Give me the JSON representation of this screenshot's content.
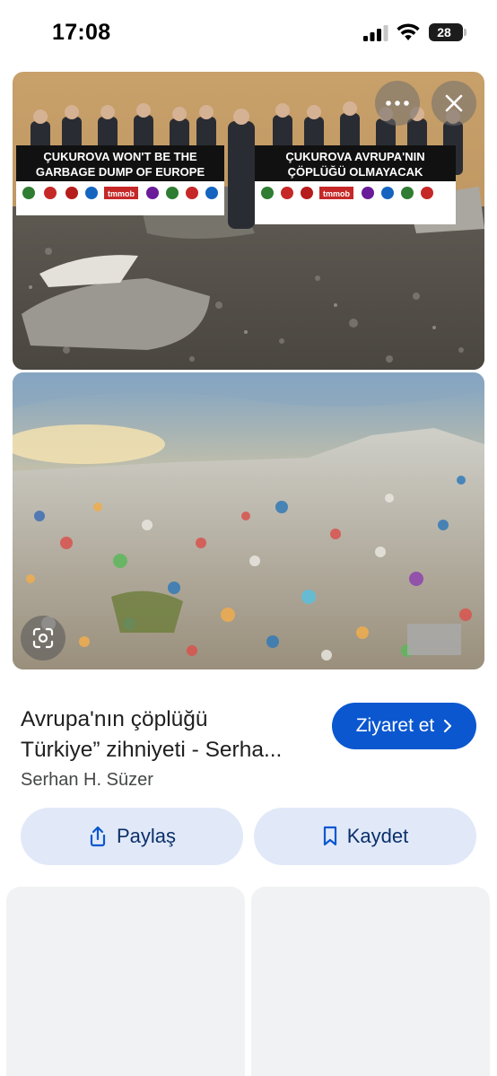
{
  "status_bar": {
    "time": "17:08",
    "battery_level": "28",
    "icons": [
      "cellular-signal-icon",
      "wifi-icon",
      "battery-icon"
    ]
  },
  "images": {
    "top": {
      "banner_left_line1": "ÇUKUROVA WON'T BE THE",
      "banner_left_line2": "GARBAGE DUMP OF EUROPE",
      "banner_right_line1": "ÇUKUROVA AVRUPA'NIN",
      "banner_right_line2": "ÇÖPLÜĞÜ OLMAYACAK",
      "logo_text_left": "tmmob",
      "logo_text_right": "tmmob"
    }
  },
  "overlay": {
    "more_icon": "more-horizontal-icon",
    "close_icon": "close-icon",
    "lens_icon": "google-lens-icon"
  },
  "result": {
    "title_line1": "Avrupa'nın çöplüğü",
    "title_line2": "Türkiye” zihniyeti - Serha...",
    "source": "Serhan H. Süzer",
    "visit_label": "Ziyaret et"
  },
  "actions": {
    "share_label": "Paylaş",
    "save_label": "Kaydet"
  },
  "colors": {
    "accent": "#0b57d0",
    "action_bg": "#e1e9f8",
    "action_text": "#0b2f6b",
    "placeholder": "#f1f2f4"
  }
}
